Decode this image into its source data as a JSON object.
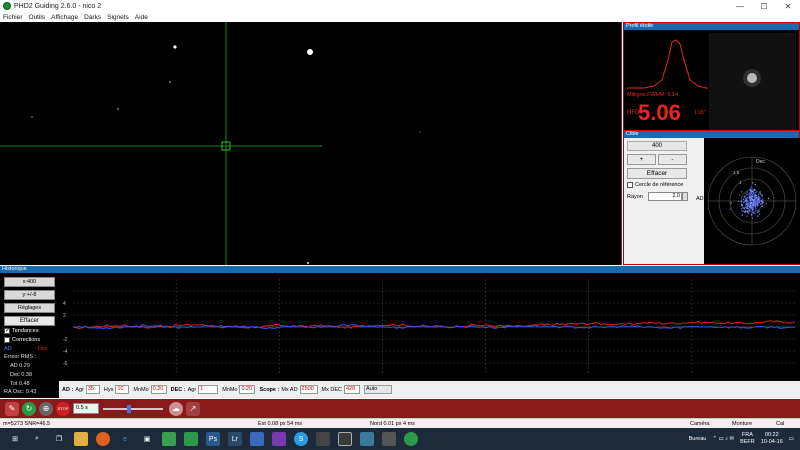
{
  "window": {
    "title": "PHD2 Guiding 2.6.0 - nico 2",
    "minimize": "—",
    "maximize": "☐",
    "close": "✕"
  },
  "menu": [
    "Fichier",
    "Outils",
    "Affichage",
    "Darks",
    "Signets",
    "Aide"
  ],
  "profile": {
    "title": "Profil étoile",
    "fwhm": "Milligne FWHM: 6.14",
    "hfd_label": "HFD:",
    "hfd_value": "5.06",
    "hfd_extra": "1.95\""
  },
  "target": {
    "title": "Cible",
    "scale": "400",
    "plus": "+",
    "minus": "-",
    "clear": "Effacer",
    "ref_circle": "Cercle de référence",
    "radius_label": "Rayon",
    "radius_value": "2.0",
    "ra_label": "AD",
    "dec_label": "Dec",
    "ring_label_1": "1.5",
    "ring_label_2": "1"
  },
  "history": {
    "title": "Historique",
    "x_scale": "x:400",
    "y_scale": "y:+/-8",
    "settings": "Réglages",
    "clear": "Effacer",
    "trends": "Tendances",
    "corrections": "Corrections",
    "ra_label": "AD",
    "dec_label": "Dec",
    "rms_title": "Erreur RMS :",
    "rms_ra": "AD 0.29",
    "rms_dec": "Dec 0.38",
    "rms_tot": "Tot 0.48",
    "ra_osc": "RA Osc: 0.43",
    "y_ticks": [
      "4",
      "2",
      "-2",
      "-4",
      "-6"
    ]
  },
  "controls": {
    "ad_label": "AD :",
    "ad_agr_label": "Agr",
    "ad_agr": "35",
    "hys_label": "Hys",
    "hys": "10",
    "mnmo_label": "MnMo",
    "ad_mnmo": "0.20",
    "dec_label": "DEC :",
    "dec_agr_label": "Agr",
    "dec_agr": "1",
    "dec_mnmo_label": "MnMo",
    "dec_mnmo": "0.20",
    "scope_label": "Scope :",
    "mx_ad_label": "Mx AD",
    "mx_ad": "2500",
    "mx_dec_label": "Mx DEC",
    "mx_dec": "428",
    "mode": "Auto"
  },
  "toolbar": {
    "exposure": "0.5 s"
  },
  "status": {
    "snr": "m=5273 SNR=46.5",
    "est": "Est  0.08 px  54 ms",
    "nord": "Nord 0.01 px 4 ms",
    "camera": "Caméra",
    "monture": "Monture",
    "cal": "Cal"
  },
  "taskbar": {
    "bureau": "Bureau",
    "lang": "FRA",
    "lang2": "BEFR",
    "time": "00:22",
    "date": "10-04-16"
  },
  "colors": {
    "ra": "#e02020",
    "dec": "#3050f0",
    "panel_title": "#1a6ab0",
    "toolbar": "#8a1a1a"
  },
  "chart_data": {
    "type": "line",
    "series": [
      {
        "name": "AD",
        "values": [
          -0.2,
          0.1,
          0.3,
          -0.1,
          0.2,
          0.4,
          0.0,
          -0.2,
          0.3,
          0.1,
          0.2,
          -0.1,
          0.3,
          0.4,
          0.1,
          0.0,
          0.3,
          0.2,
          0.1,
          0.4,
          0.5,
          0.6,
          0.4,
          0.7,
          0.6,
          0.8,
          0.7,
          0.6,
          0.9,
          0.8
        ]
      },
      {
        "name": "Dec",
        "values": [
          0.1,
          -0.2,
          0.0,
          0.3,
          -0.1,
          0.1,
          0.2,
          0.0,
          -0.2,
          0.1,
          0.0,
          0.3,
          0.1,
          -0.1,
          0.2,
          0.0,
          0.1,
          -0.1,
          0.2,
          0.1,
          0.0,
          -0.1,
          0.1,
          0.0,
          -0.2,
          0.1,
          0.0,
          -0.1,
          0.0,
          -0.2
        ]
      }
    ],
    "ylim": [
      -8,
      8
    ]
  }
}
